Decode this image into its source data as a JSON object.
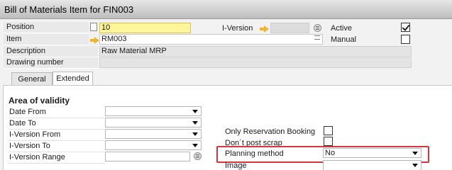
{
  "window": {
    "title": "Bill of Materials Item for FIN003"
  },
  "header": {
    "position_label": "Position",
    "position_value": "10",
    "item_label": "Item",
    "item_value": "RM003",
    "description_label": "Description",
    "description_value": "Raw Material MRP",
    "drawing_label": "Drawing number",
    "drawing_value": "",
    "iversion_label": "I-Version",
    "iversion_value": "",
    "active_label": "Active",
    "active_checked": true,
    "manual_label": "Manual",
    "manual_checked": false
  },
  "tabs": [
    {
      "label": "General",
      "active": false
    },
    {
      "label": "Extended",
      "active": true
    }
  ],
  "extended": {
    "section_title": "Area of validity",
    "fields": [
      {
        "label": "Date From",
        "value": ""
      },
      {
        "label": "Date To",
        "value": ""
      },
      {
        "label": "I-Version From",
        "value": ""
      },
      {
        "label": "I-Version To",
        "value": ""
      },
      {
        "label": "I-Version Range",
        "value": ""
      }
    ],
    "only_reservation_label": "Only Reservation Booking",
    "dont_post_scrap_label": "Don´t post scrap",
    "planning_method_label": "Planning method",
    "planning_method_value": "No",
    "image_label": "Image",
    "image_value": ""
  },
  "colors": {
    "highlight": "#d9343c",
    "mandatory_field": "#fff59a",
    "link_arrow": "#f2b52a"
  }
}
